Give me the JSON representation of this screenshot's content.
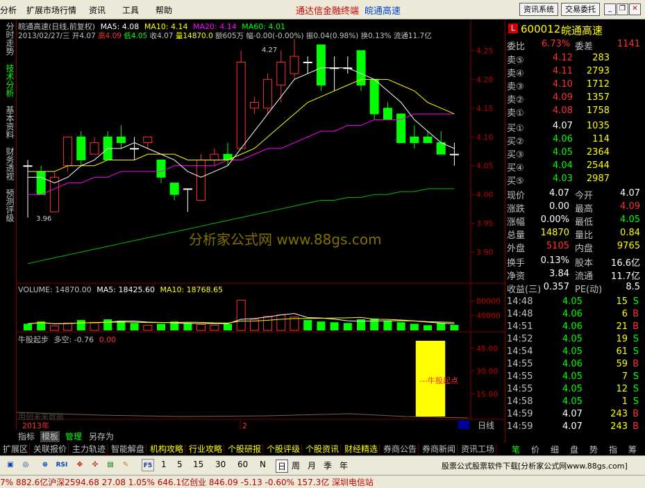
{
  "menu": {
    "items": [
      "分析",
      "扩展市场行情",
      "资讯",
      "工具",
      "帮助"
    ],
    "title": "通达信金融终端",
    "stock": "皖通高速",
    "btn_news": "资讯系统",
    "btn_trade": "交易委托"
  },
  "left_tabs": [
    "分时走势",
    "技术分析",
    "基本资料",
    "财务透视",
    "预测评级"
  ],
  "header": {
    "name_line": "皖通高速(日线,前复权)",
    "ma5": "MA5: 4.08",
    "ma10": "MA10: 4.14",
    "ma20": "MA20: 4.14",
    "ma60": "MA60: 4.01",
    "date_line": "2013/02/27/三 开4.07",
    "high": "高4.09",
    "low": "低4.05",
    "close": "收4.07",
    "vol": "量14870.0",
    "amount": "额605万",
    "change": "幅-0.00(-0.00%)",
    "amplitude": "振0.04(0.98%)",
    "turnover": "换0.13%",
    "float": "流通11.7亿"
  },
  "price_axis": [
    "4.25",
    "4.20",
    "4.15",
    "4.10",
    "4.05",
    "4.00",
    "3.95",
    "3.90"
  ],
  "annotations": {
    "high_mark": "4.27",
    "low_mark": "3.96"
  },
  "watermark": "分析家公式网 www.88gs.com",
  "volume": {
    "label": "VOLUME: 14870.00",
    "ma5": "MA5: 18425.60",
    "ma10": "MA10: 18768.65",
    "axis": [
      "80000",
      "40000"
    ]
  },
  "indicator": {
    "label": "牛股起步",
    "duokong": "多空: -0.76",
    "value": "0.00",
    "axis": [
      "45.00",
      "30.00",
      "15.00"
    ],
    "signal_text": "---牛股起点",
    "footer": "用创未来数据"
  },
  "timeline": {
    "year": "2013年",
    "marker": "2",
    "period": "日线"
  },
  "chart_data": {
    "type": "candlestick",
    "candles": [
      {
        "o": 4.05,
        "h": 4.06,
        "l": 3.96,
        "c": 4.05
      },
      {
        "o": 4.04,
        "h": 4.05,
        "l": 4.0,
        "c": 4.0
      },
      {
        "o": 3.97,
        "h": 4.04,
        "l": 3.97,
        "c": 4.03
      },
      {
        "o": 4.05,
        "h": 4.1,
        "l": 4.04,
        "c": 4.1
      },
      {
        "o": 4.1,
        "h": 4.11,
        "l": 4.05,
        "c": 4.06
      },
      {
        "o": 4.07,
        "h": 4.1,
        "l": 4.07,
        "c": 4.09
      },
      {
        "o": 4.1,
        "h": 4.11,
        "l": 4.06,
        "c": 4.06
      },
      {
        "o": 4.1,
        "h": 4.12,
        "l": 4.08,
        "c": 4.09
      },
      {
        "o": 4.08,
        "h": 4.1,
        "l": 4.06,
        "c": 4.08
      },
      {
        "o": 4.09,
        "h": 4.1,
        "l": 4.08,
        "c": 4.1
      },
      {
        "o": 4.06,
        "h": 4.06,
        "l": 4.02,
        "c": 4.03
      },
      {
        "o": 4.02,
        "h": 4.02,
        "l": 3.99,
        "c": 4.0
      },
      {
        "o": 4.01,
        "h": 4.01,
        "l": 3.97,
        "c": 4.01
      },
      {
        "o": 3.99,
        "h": 4.07,
        "l": 3.99,
        "c": 4.06
      },
      {
        "o": 4.06,
        "h": 4.08,
        "l": 4.05,
        "c": 4.07
      },
      {
        "o": 4.07,
        "h": 4.09,
        "l": 4.05,
        "c": 4.06
      },
      {
        "o": 4.08,
        "h": 4.25,
        "l": 4.08,
        "c": 4.23
      },
      {
        "o": 4.15,
        "h": 4.17,
        "l": 4.14,
        "c": 4.16
      },
      {
        "o": 4.15,
        "h": 4.21,
        "l": 4.14,
        "c": 4.2
      },
      {
        "o": 4.19,
        "h": 4.25,
        "l": 4.16,
        "c": 4.23
      },
      {
        "o": 4.21,
        "h": 4.27,
        "l": 4.2,
        "c": 4.24
      },
      {
        "o": 4.23,
        "h": 4.24,
        "l": 4.21,
        "c": 4.23
      },
      {
        "o": 4.26,
        "h": 4.26,
        "l": 4.18,
        "c": 4.19
      },
      {
        "o": 4.22,
        "h": 4.24,
        "l": 4.18,
        "c": 4.22
      },
      {
        "o": 4.22,
        "h": 4.24,
        "l": 4.21,
        "c": 4.22
      },
      {
        "o": 4.25,
        "h": 4.25,
        "l": 4.18,
        "c": 4.19
      },
      {
        "o": 4.2,
        "h": 4.2,
        "l": 4.13,
        "c": 4.14
      },
      {
        "o": 4.15,
        "h": 4.16,
        "l": 4.13,
        "c": 4.13
      },
      {
        "o": 4.14,
        "h": 4.14,
        "l": 4.09,
        "c": 4.09
      },
      {
        "o": 4.1,
        "h": 4.12,
        "l": 4.08,
        "c": 4.09
      },
      {
        "o": 4.1,
        "h": 4.11,
        "l": 4.09,
        "c": 4.09
      },
      {
        "o": 4.09,
        "h": 4.11,
        "l": 4.07,
        "c": 4.07
      },
      {
        "o": 4.07,
        "h": 4.09,
        "l": 4.05,
        "c": 4.07
      }
    ],
    "ylim": [
      3.87,
      4.28
    ],
    "volumes": [
      18000,
      24000,
      12000,
      20000,
      28000,
      22000,
      30000,
      26000,
      20000,
      14000,
      18000,
      24000,
      20000,
      16000,
      14000,
      18000,
      82000,
      30000,
      38000,
      42000,
      36000,
      28000,
      24000,
      22000,
      20000,
      30000,
      32000,
      26000,
      22000,
      18000,
      14000,
      20000,
      14870
    ],
    "vol_ylim": [
      0,
      90000
    ],
    "ma5": [
      4.03,
      4.03,
      4.02,
      4.03,
      4.05,
      4.06,
      4.08,
      4.08,
      4.09,
      4.08,
      4.07,
      4.06,
      4.04,
      4.03,
      4.04,
      4.05,
      4.08,
      4.11,
      4.14,
      4.17,
      4.2,
      4.21,
      4.22,
      4.22,
      4.22,
      4.21,
      4.2,
      4.18,
      4.16,
      4.13,
      4.11,
      4.09,
      4.08
    ],
    "ma10": [
      4.04,
      4.04,
      4.04,
      4.05,
      4.05,
      4.05,
      4.06,
      4.06,
      4.06,
      4.07,
      4.07,
      4.07,
      4.06,
      4.06,
      4.06,
      4.06,
      4.07,
      4.08,
      4.1,
      4.12,
      4.14,
      4.16,
      4.17,
      4.18,
      4.19,
      4.2,
      4.2,
      4.2,
      4.19,
      4.18,
      4.16,
      4.15,
      4.14
    ],
    "ma20": [
      4.0,
      4.0,
      4.01,
      4.02,
      4.02,
      4.03,
      4.03,
      4.04,
      4.04,
      4.04,
      4.04,
      4.05,
      4.05,
      4.05,
      4.05,
      4.06,
      4.06,
      4.07,
      4.08,
      4.08,
      4.09,
      4.1,
      4.11,
      4.11,
      4.12,
      4.12,
      4.13,
      4.13,
      4.13,
      4.14,
      4.14,
      4.14,
      4.14
    ],
    "ma60": [
      3.88,
      3.885,
      3.89,
      3.895,
      3.9,
      3.905,
      3.91,
      3.915,
      3.92,
      3.925,
      3.93,
      3.935,
      3.94,
      3.945,
      3.95,
      3.955,
      3.96,
      3.965,
      3.97,
      3.975,
      3.98,
      3.985,
      3.99,
      3.99,
      3.995,
      3.995,
      4.0,
      4.0,
      4.005,
      4.005,
      4.01,
      4.01,
      4.01
    ],
    "indicator_signal_index": [
      29,
      31
    ],
    "indicator_ylim": [
      0,
      55
    ],
    "indicator_signal_top": 50
  },
  "quote": {
    "code": "600012",
    "name": "皖通高速",
    "weibi_label": "委比",
    "weibi": "6.73%",
    "weicha_label": "委差",
    "weicha": "1141",
    "sells": [
      {
        "label": "卖⑤",
        "price": "4.12",
        "vol": "283"
      },
      {
        "label": "卖④",
        "price": "4.11",
        "vol": "2793"
      },
      {
        "label": "卖③",
        "price": "4.10",
        "vol": "1712"
      },
      {
        "label": "卖②",
        "price": "4.09",
        "vol": "1357"
      },
      {
        "label": "卖①",
        "price": "4.08",
        "vol": "1758"
      }
    ],
    "buys": [
      {
        "label": "买①",
        "price": "4.07",
        "vol": "1035"
      },
      {
        "label": "买②",
        "price": "4.06",
        "vol": "114"
      },
      {
        "label": "买③",
        "price": "4.05",
        "vol": "2364"
      },
      {
        "label": "买④",
        "price": "4.04",
        "vol": "2544"
      },
      {
        "label": "买⑤",
        "price": "4.03",
        "vol": "2987"
      }
    ],
    "stats": [
      {
        "l1": "现价",
        "v1": "4.07",
        "l2": "今开",
        "v2": "4.07"
      },
      {
        "l1": "涨跌",
        "v1": "0.00",
        "l2": "最高",
        "v2": "4.09"
      },
      {
        "l1": "涨幅",
        "v1": "0.00%",
        "l2": "最低",
        "v2": "4.05"
      },
      {
        "l1": "总量",
        "v1": "14870",
        "l2": "量比",
        "v2": "0.84"
      },
      {
        "l1": "外盘",
        "v1": "5105",
        "l2": "内盘",
        "v2": "9765"
      }
    ],
    "stats2": [
      {
        "l1": "换手",
        "v1": "0.13%",
        "l2": "股本",
        "v2": "16.6亿"
      },
      {
        "l1": "净资",
        "v1": "3.84",
        "l2": "流通",
        "v2": "11.7亿"
      },
      {
        "l1": "收益(三)",
        "v1": "0.357",
        "l2": "PE(动)",
        "v2": "8.5"
      }
    ],
    "ticks": [
      {
        "t": "14:48",
        "p": "4.05",
        "v": "15",
        "d": "S"
      },
      {
        "t": "14:48",
        "p": "4.06",
        "v": "6",
        "d": "B"
      },
      {
        "t": "14:51",
        "p": "4.06",
        "v": "21",
        "d": "B"
      },
      {
        "t": "14:52",
        "p": "4.05",
        "v": "19",
        "d": "S"
      },
      {
        "t": "14:54",
        "p": "4.05",
        "v": "61",
        "d": "S"
      },
      {
        "t": "14:55",
        "p": "4.06",
        "v": "59",
        "d": "B"
      },
      {
        "t": "14:55",
        "p": "4.05",
        "v": "7",
        "d": "S"
      },
      {
        "t": "14:55",
        "p": "4.05",
        "v": "12",
        "d": "S"
      },
      {
        "t": "14:58",
        "p": "4.05",
        "v": "1",
        "d": "S"
      },
      {
        "t": "14:59",
        "p": "4.07",
        "v": "243",
        "d": "B"
      },
      {
        "t": "14:59",
        "p": "4.07",
        "v": "243",
        "d": "B"
      }
    ]
  },
  "bottom_tabs": [
    "扩展区",
    "关联报价",
    "主力轨迹",
    "智能解盘",
    "机构攻略",
    "行业攻略",
    "个股研报",
    "个股评级",
    "个股资讯",
    "财经精选",
    "券商公告",
    "券商新闻",
    "资讯工场"
  ],
  "sub_tabs": [
    "指标",
    "模板",
    "管理",
    "另存为"
  ],
  "right_tabs": [
    "笔",
    "价",
    "细",
    "盘",
    "势",
    "指",
    "筹"
  ],
  "toolbar": {
    "periods": [
      "1",
      "5",
      "15",
      "30",
      "60",
      "N",
      "日",
      "周",
      "月",
      "季",
      "年"
    ],
    "ad": "股票公式股票软件下载[分析家公式网www.88gs.com]"
  },
  "status": {
    "text": "7%  882.6亿沪深2594.68  27.08  1.05%   646.1亿创业 846.09  -5.13  -0.60%  157.3亿   深圳电信站"
  }
}
